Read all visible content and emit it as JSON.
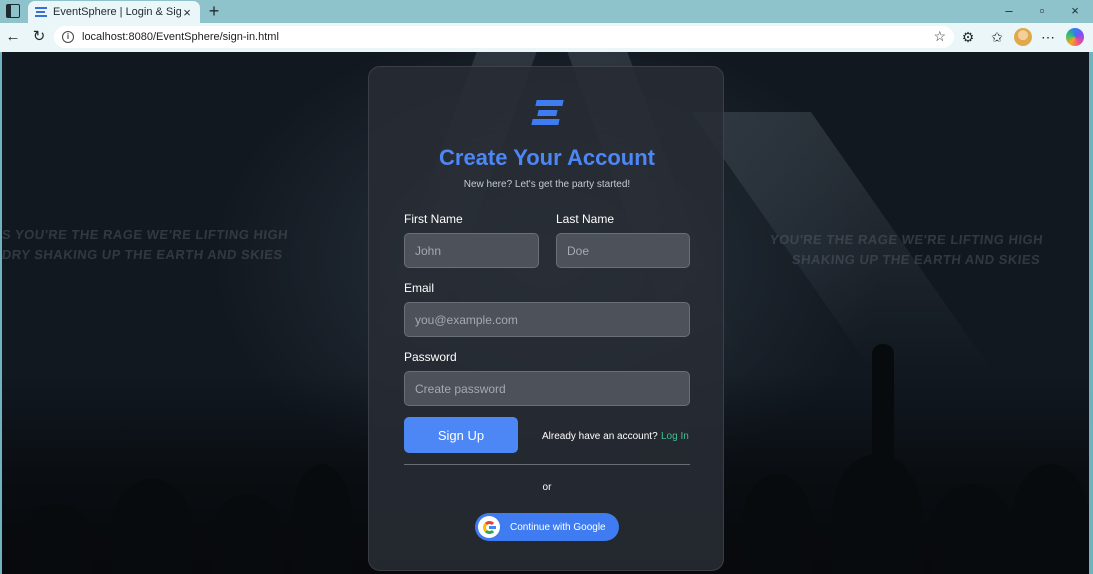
{
  "browser": {
    "tab_title": "EventSphere | Login & Sign Up",
    "tab_close": "×",
    "new_tab": "+",
    "url": "localhost:8080/EventSphere/sign-in.html",
    "window_controls": {
      "minimize": "–",
      "maximize": "▫",
      "close": "×"
    },
    "icons": [
      "sidebar-icon",
      "back-icon",
      "reload-icon",
      "info-icon",
      "star-icon",
      "extensions-icon",
      "favorites-icon",
      "profile-icon",
      "more-icon",
      "copilot-icon"
    ]
  },
  "background": {
    "left_text_1": "S YOU'RE THE RAGE WE'RE LIFTING HIGH",
    "left_text_2": "DRY SHAKING UP THE EARTH AND SKIES",
    "right_text_1": "YOU'RE THE RAGE WE'RE LIFTING HIGH",
    "right_text_2": "SHAKING UP THE EARTH AND SKIES"
  },
  "form": {
    "title": "Create Your Account",
    "subtitle": "New here? Let's get the party started!",
    "first_name_label": "First Name",
    "first_name_placeholder": "John",
    "last_name_label": "Last Name",
    "last_name_placeholder": "Doe",
    "email_label": "Email",
    "email_placeholder": "you@example.com",
    "password_label": "Password",
    "password_placeholder": "Create password",
    "signup_button": "Sign Up",
    "have_account_text": "Already have an account?",
    "login_link": "Log In",
    "or_text": "or",
    "google_button": "Continue with Google"
  },
  "colors": {
    "accent": "#4d87f6",
    "link": "#3fbf8f",
    "card_bg": "#2a2d34",
    "input_bg": "#4d5159"
  }
}
